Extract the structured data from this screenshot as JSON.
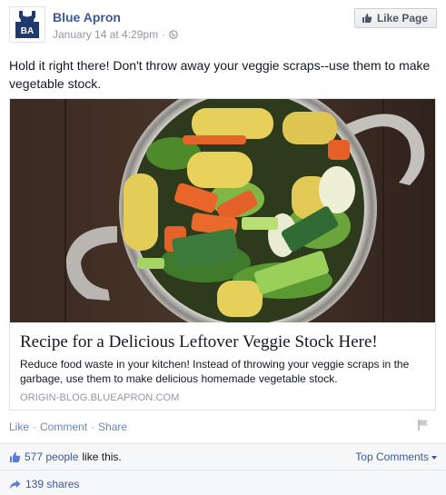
{
  "header": {
    "page_name": "Blue Apron",
    "timestamp": "January 14 at 4:29pm",
    "meta_sep": "·",
    "avatar_text": "BA",
    "like_page_label": "Like Page"
  },
  "post": {
    "text": "Hold it right there! Don't throw away your veggie scraps--use them to make vegetable stock."
  },
  "attachment": {
    "title": "Recipe for a Delicious Leftover Veggie Stock Here!",
    "description": "Reduce food waste in your kitchen! Instead of throwing your veggie scraps in the garbage, use them to make delicious homemade vegetable stock.",
    "domain": "ORIGIN-BLOG.BLUEAPRON.COM"
  },
  "actions": {
    "like": "Like",
    "comment": "Comment",
    "share": "Share",
    "sep": "·"
  },
  "likes": {
    "people_text": "577 people",
    "suffix": "like this.",
    "top_comments": "Top Comments"
  },
  "shares": {
    "text": "139 shares"
  },
  "colors": {
    "link_blue": "#3b5998",
    "action_blue": "#6d84b4",
    "muted_gray": "#9197a3",
    "brand_blue": "#1e3a6e"
  }
}
